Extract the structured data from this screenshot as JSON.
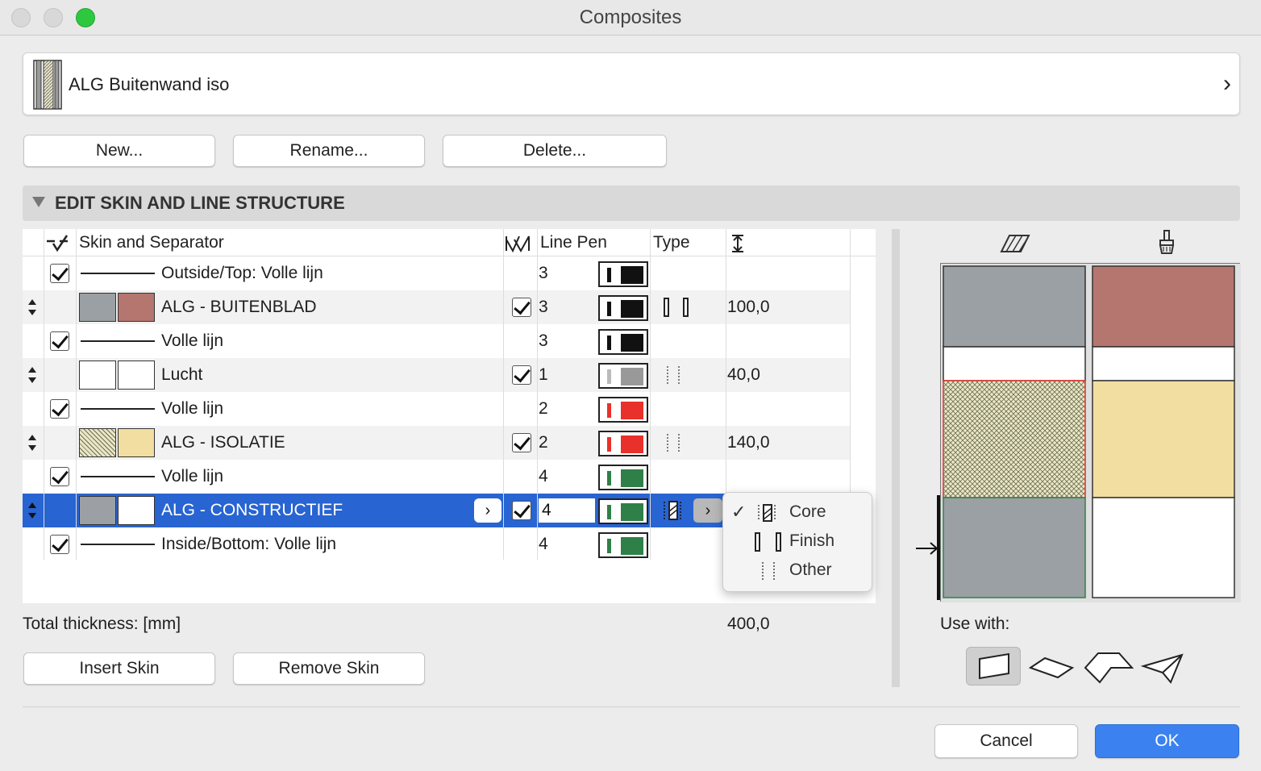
{
  "window": {
    "title": "Composites"
  },
  "composite": {
    "name": "ALG Buitenwand iso",
    "chevron": "›"
  },
  "buttons": {
    "new": "New...",
    "rename": "Rename...",
    "delete": "Delete...",
    "insert_skin": "Insert Skin",
    "remove_skin": "Remove Skin",
    "cancel": "Cancel",
    "ok": "OK"
  },
  "section": {
    "title": "EDIT SKIN AND LINE STRUCTURE"
  },
  "table": {
    "headers": {
      "skin": "Skin and Separator",
      "line_pen": "Line Pen",
      "type": "Type"
    },
    "rows": [
      {
        "kind": "line",
        "label": "Outside/Top: Volle lijn",
        "pen": "3",
        "pen_color": "#111111"
      },
      {
        "kind": "skin",
        "label": "ALG - BUITENBLAD",
        "pen": "3",
        "pen_color": "#111111",
        "fill1": "#9aa0a3",
        "fill2": "#b5766f",
        "type": "Finish",
        "thickness": "100,0"
      },
      {
        "kind": "line",
        "label": "Volle lijn",
        "pen": "3",
        "pen_color": "#111111"
      },
      {
        "kind": "skin",
        "label": "Lucht",
        "pen": "1",
        "pen_color": "#999999",
        "fill1": "#ffffff",
        "fill2": "#ffffff",
        "type": "Other",
        "thickness": "40,0"
      },
      {
        "kind": "line",
        "label": "Volle lijn",
        "pen": "2",
        "pen_color": "#e8312a"
      },
      {
        "kind": "skin",
        "label": "ALG - ISOLATIE",
        "pen": "2",
        "pen_color": "#e8312a",
        "fill1": "#e9e6c8",
        "fill2": "#f3dea1",
        "type": "Other",
        "thickness": "140,0"
      },
      {
        "kind": "line",
        "label": "Volle lijn",
        "pen": "4",
        "pen_color": "#2f8048"
      },
      {
        "kind": "skin",
        "label": "ALG - CONSTRUCTIEF",
        "pen": "4",
        "pen_color": "#2f8048",
        "fill1": "#9aa0a3",
        "fill2": "#ffffff",
        "type": "Core",
        "thickness": "",
        "selected": true
      },
      {
        "kind": "line",
        "label": "Inside/Bottom: Volle lijn",
        "pen": "4",
        "pen_color": "#2f8048"
      }
    ]
  },
  "type_menu": {
    "items": [
      "Core",
      "Finish",
      "Other"
    ],
    "checked": "Core"
  },
  "total": {
    "label": "Total thickness: [mm]",
    "value": "400,0"
  },
  "use_with": {
    "label": "Use with:"
  },
  "colors": {
    "accent": "#2864d2",
    "ok": "#3b82f0"
  }
}
